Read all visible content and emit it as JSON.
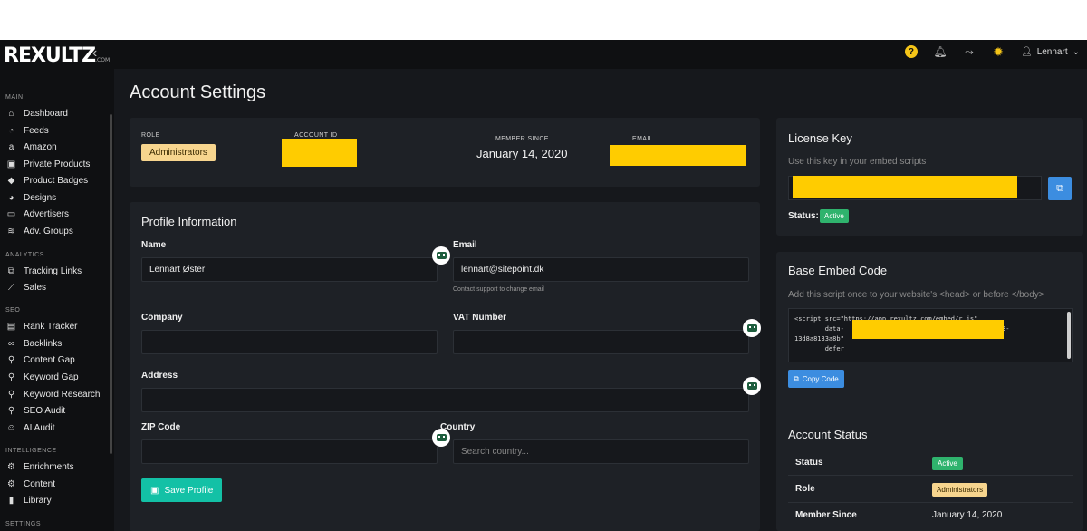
{
  "header": {
    "logo": "REXULTZ",
    "logo_suffix": ".COM",
    "user_name": "Lennart",
    "icons": [
      "help-icon",
      "bell-icon",
      "route-icon",
      "sun-icon",
      "user-icon"
    ]
  },
  "sidebar": {
    "sections": [
      {
        "title": "MAIN",
        "items": [
          {
            "label": "Dashboard",
            "icon": "home-icon"
          },
          {
            "label": "Feeds",
            "icon": "rss-icon"
          },
          {
            "label": "Amazon",
            "icon": "amazon-icon"
          },
          {
            "label": "Private Products",
            "icon": "lock-icon"
          },
          {
            "label": "Product Badges",
            "icon": "tag-icon"
          },
          {
            "label": "Designs",
            "icon": "palette-icon"
          },
          {
            "label": "Advertisers",
            "icon": "card-icon"
          },
          {
            "label": "Adv. Groups",
            "icon": "layers-icon"
          }
        ]
      },
      {
        "title": "ANALYTICS",
        "items": [
          {
            "label": "Tracking Links",
            "icon": "external-link-icon"
          },
          {
            "label": "Sales",
            "icon": "chart-line-icon"
          }
        ]
      },
      {
        "title": "SEO",
        "items": [
          {
            "label": "Rank Tracker",
            "icon": "bar-chart-icon"
          },
          {
            "label": "Backlinks",
            "icon": "link-icon"
          },
          {
            "label": "Content Gap",
            "icon": "search-icon"
          },
          {
            "label": "Keyword Gap",
            "icon": "search-icon"
          },
          {
            "label": "Keyword Research",
            "icon": "search-icon"
          },
          {
            "label": "SEO Audit",
            "icon": "search-icon"
          },
          {
            "label": "AI Audit",
            "icon": "robot-icon"
          }
        ]
      },
      {
        "title": "INTELLIGENCE",
        "items": [
          {
            "label": "Enrichments",
            "icon": "gear-icon"
          },
          {
            "label": "Content",
            "icon": "gear-icon"
          },
          {
            "label": "Library",
            "icon": "book-icon"
          }
        ]
      },
      {
        "title": "SETTINGS",
        "items": []
      }
    ]
  },
  "page": {
    "title": "Account Settings"
  },
  "summary": {
    "role_label": "ROLE",
    "role_value": "Administrators",
    "account_id_label": "ACCOUNT ID",
    "member_since_label": "MEMBER SINCE",
    "member_since_value": "January 14, 2020",
    "email_label": "EMAIL"
  },
  "profile": {
    "title": "Profile Information",
    "name_label": "Name",
    "name_value": "Lennart Øster",
    "email_label": "Email",
    "email_value": "lennart@sitepoint.dk",
    "email_hint": "Contact support to change email",
    "company_label": "Company",
    "vat_label": "VAT Number",
    "address_label": "Address",
    "zip_label": "ZIP Code",
    "country_label": "Country",
    "country_placeholder": "Search country...",
    "save_label": "Save Profile"
  },
  "license": {
    "title": "License Key",
    "subtitle": "Use this key in your embed scripts",
    "status_label": "Status:",
    "status_value": "Active"
  },
  "embed": {
    "title": "Base Embed Code",
    "subtitle": "Add this script once to your website's <head> or before </body>",
    "code_line1": "<script src=\"https://app.rexultz.com/embed/r.js\"",
    "code_line2": "        data-",
    "code_line2_end": "3-",
    "code_line3": "13d8a8133a8b\"",
    "code_line4": "        defer",
    "copy_label": "Copy Code"
  },
  "account_status": {
    "title": "Account Status",
    "rows": [
      {
        "label": "Status",
        "value": "Active"
      },
      {
        "label": "Role",
        "value": "Administrators"
      },
      {
        "label": "Member Since",
        "value": "January 14, 2020"
      }
    ]
  },
  "colors": {
    "accent_teal": "#13c1a6",
    "accent_blue": "#3c8de0",
    "active_green": "#2fb36d",
    "role_yellow": "#f7d58e",
    "redaction": "#ffcc00"
  }
}
